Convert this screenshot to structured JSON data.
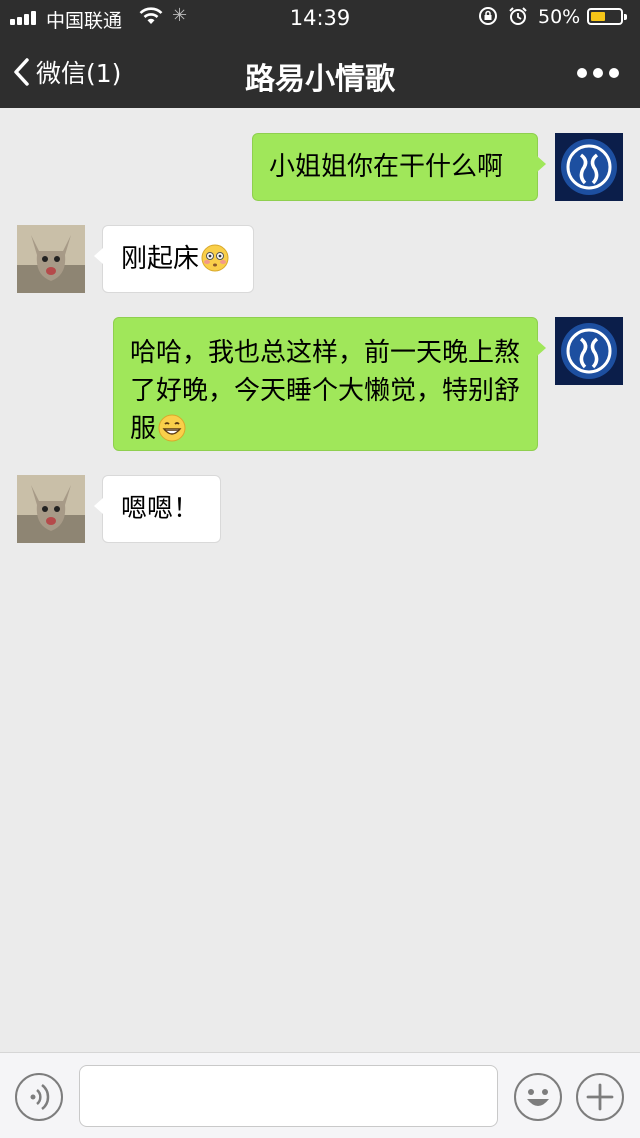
{
  "status_bar": {
    "carrier": "中国联通",
    "time": "14:39",
    "battery_percent": "50%",
    "battery_level": 0.5,
    "battery_color": "#f5c518"
  },
  "nav": {
    "back_label": "微信(1)",
    "title": "路易小情歌",
    "back_icon": "chevron-left-icon",
    "more_icon": "more-dots-icon"
  },
  "messages": [
    {
      "direction": "outgoing",
      "text": "小姐姐你在干什么啊",
      "emoji": null
    },
    {
      "direction": "incoming",
      "text": "刚起床",
      "emoji": "flushed-face"
    },
    {
      "direction": "outgoing",
      "text": "哈哈，我也总这样，前一天晚上熬了好晚，今天睡个大懒觉，特别舒服",
      "emoji": "grinning-face"
    },
    {
      "direction": "incoming",
      "text": "嗯嗯！",
      "emoji": null
    }
  ],
  "input_bar": {
    "voice_icon": "voice-icon",
    "input_value": "",
    "emoji_icon": "emoji-icon",
    "plus_icon": "plus-icon"
  },
  "colors": {
    "outgoing_bubble": "#a0e75a",
    "incoming_bubble": "#ffffff",
    "background": "#ebebeb",
    "header": "#2e2e2e"
  }
}
